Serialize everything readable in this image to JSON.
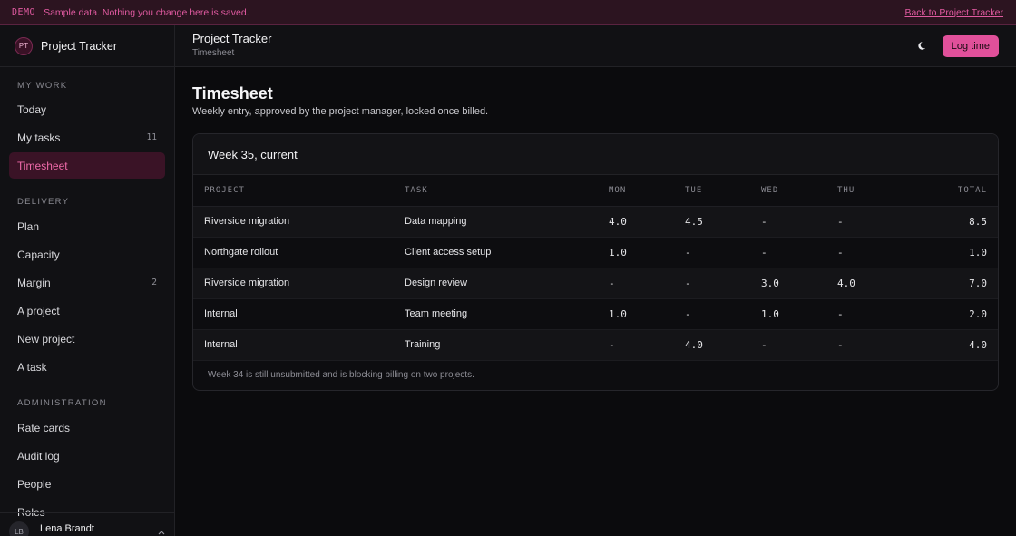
{
  "banner": {
    "tag": "DEMO",
    "message": "Sample data. Nothing you change here is saved.",
    "back_link": "Back to Project Tracker"
  },
  "sidebar": {
    "brand_initials": "PT",
    "brand_name": "Project Tracker",
    "sections": [
      {
        "title": "MY WORK",
        "items": [
          {
            "label": "Today",
            "count": ""
          },
          {
            "label": "My tasks",
            "count": "11"
          },
          {
            "label": "Timesheet",
            "count": "",
            "active": true
          }
        ]
      },
      {
        "title": "DELIVERY",
        "items": [
          {
            "label": "Plan",
            "count": ""
          },
          {
            "label": "Capacity",
            "count": ""
          },
          {
            "label": "Margin",
            "count": "2"
          },
          {
            "label": "A project",
            "count": ""
          },
          {
            "label": "New project",
            "count": ""
          },
          {
            "label": "A task",
            "count": ""
          }
        ]
      },
      {
        "title": "ADMINISTRATION",
        "items": [
          {
            "label": "Rate cards",
            "count": ""
          },
          {
            "label": "Audit log",
            "count": ""
          },
          {
            "label": "People",
            "count": ""
          },
          {
            "label": "Roles",
            "count": ""
          }
        ]
      }
    ],
    "user": {
      "initials": "LB",
      "name": "Lena Brandt"
    }
  },
  "topbar": {
    "title": "Project Tracker",
    "subtitle": "Timesheet",
    "theme_icon": "moon-icon",
    "log_time_label": "Log time"
  },
  "page": {
    "title": "Timesheet",
    "subtitle": "Weekly entry, approved by the project manager, locked once billed."
  },
  "timesheet": {
    "week_label": "Week 35, current",
    "columns": [
      "PROJECT",
      "TASK",
      "MON",
      "TUE",
      "WED",
      "THU",
      "TOTAL"
    ],
    "rows": [
      [
        "Riverside migration",
        "Data mapping",
        "4.0",
        "4.5",
        "-",
        "-",
        "8.5"
      ],
      [
        "Northgate rollout",
        "Client access setup",
        "1.0",
        "-",
        "-",
        "-",
        "1.0"
      ],
      [
        "Riverside migration",
        "Design review",
        "-",
        "-",
        "3.0",
        "4.0",
        "7.0"
      ],
      [
        "Internal",
        "Team meeting",
        "1.0",
        "-",
        "1.0",
        "-",
        "2.0"
      ],
      [
        "Internal",
        "Training",
        "-",
        "4.0",
        "-",
        "-",
        "4.0"
      ]
    ],
    "footer_note": "Week 34 is still unsubmitted and is blocking billing on two projects."
  },
  "colors": {
    "accent": "#e0509a",
    "banner_bg": "#2c1420",
    "active_nav_bg": "#3a1326"
  }
}
